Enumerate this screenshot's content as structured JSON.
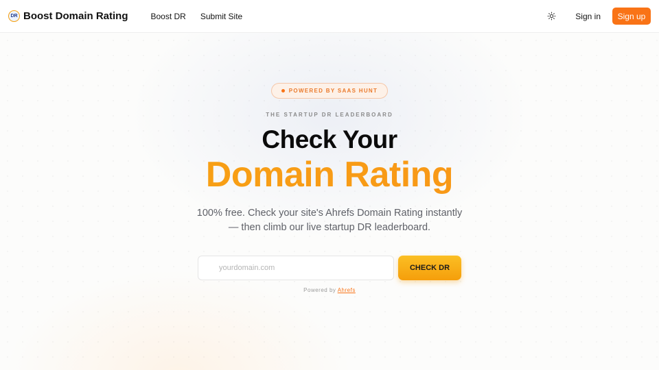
{
  "header": {
    "logo_badge": "DR",
    "title": "Boost Domain Rating",
    "nav": [
      {
        "label": "Boost DR"
      },
      {
        "label": "Submit Site"
      }
    ],
    "theme_icon": "sun-icon",
    "signin_label": "Sign in",
    "signup_label": "Sign up"
  },
  "hero": {
    "pill_text": "POWERED BY SAAS HUNT",
    "eyebrow": "THE STARTUP DR LEADERBOARD",
    "title_line1": "Check Your",
    "title_line2": "Domain Rating",
    "subtitle": "100% free. Check your site's Ahrefs Domain Rating instantly — then climb our live startup DR leaderboard.",
    "input_value": "",
    "input_placeholder": "yourdomain.com",
    "button_label": "CHECK DR",
    "powered_prefix": "Powered by",
    "powered_link": "Ahrefs"
  },
  "colors": {
    "accent": "#f97316",
    "gradient_start": "#f6a413",
    "gradient_end": "#f7931a"
  }
}
